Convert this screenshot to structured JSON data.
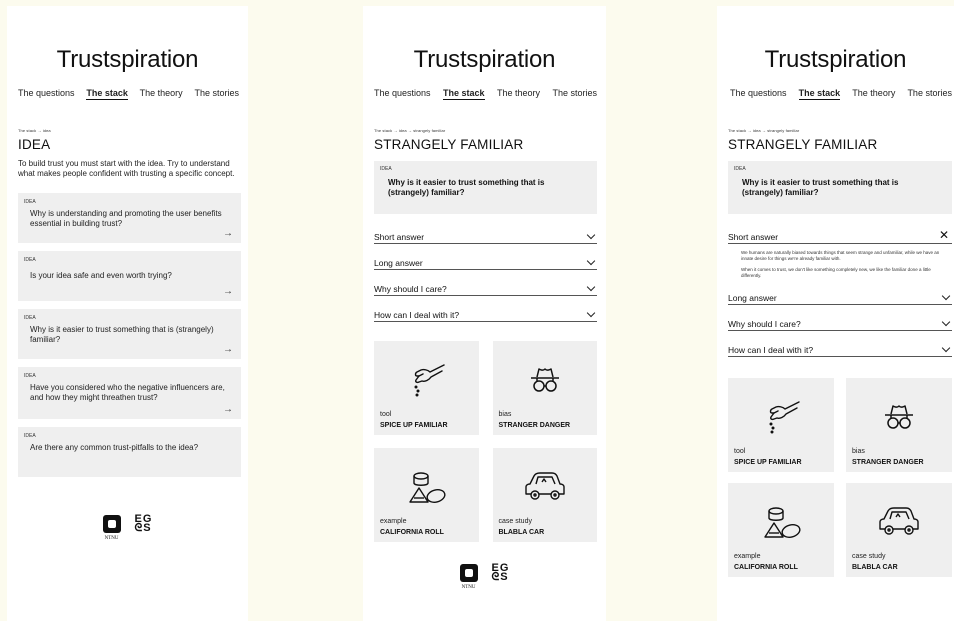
{
  "app": {
    "title": "Trustspiration"
  },
  "nav": [
    "The questions",
    "The stack",
    "The theory",
    "The stories"
  ],
  "screen1": {
    "breadcrumb": "The stack  →  idea",
    "heading": "IDEA",
    "intro": "To build trust you must start with the idea. Try to understand what makes people confident with trusting a specific concept.",
    "cards": [
      {
        "tag": "IDEA",
        "question": "Why is understanding and promoting the user benefits essential in building trust?"
      },
      {
        "tag": "IDEA",
        "question": "Is your idea safe and even worth trying?"
      },
      {
        "tag": "IDEA",
        "question": "Why is it easier to trust something that is (strangely) familiar?"
      },
      {
        "tag": "IDEA",
        "question": "Have you considered who the negative influencers are, and how they might threathen trust?"
      },
      {
        "tag": "IDEA",
        "question": "Are there any common trust-pitfalls to the idea?"
      }
    ],
    "arrow": "→"
  },
  "detail": {
    "breadcrumb": "The stack  →  idea  →  strangely familiar",
    "heading": "STRANGELY FAMILIAR",
    "tag": "IDEA",
    "question": "Why is it easier to trust something that is (strangely) familiar?",
    "accordion": [
      "Short answer",
      "Long answer",
      "Why should I care?",
      "How can I deal with it?"
    ],
    "short_answer_body": [
      "We humans are naturally biased towards things that seem strange and unfamiliar, while we have an innate desire for things we're already familiar with.",
      "When it comes to trust, we don't like something completely new, we like the familiar done a little differently."
    ],
    "tiles": [
      {
        "type": "tool",
        "name": "SPICE UP FAMILIAR",
        "icon": "salt-hand-icon"
      },
      {
        "type": "bias",
        "name": "STRANGER DANGER",
        "icon": "spy-icon"
      },
      {
        "type": "example",
        "name": "CALIFORNIA ROLL",
        "icon": "sushi-icon"
      },
      {
        "type": "case study",
        "name": "BLABLA CAR",
        "icon": "car-icon"
      }
    ]
  },
  "logos": {
    "ntnu": "NTNU",
    "egos_top": "EG",
    "egos_bottom": "ᘓS"
  }
}
